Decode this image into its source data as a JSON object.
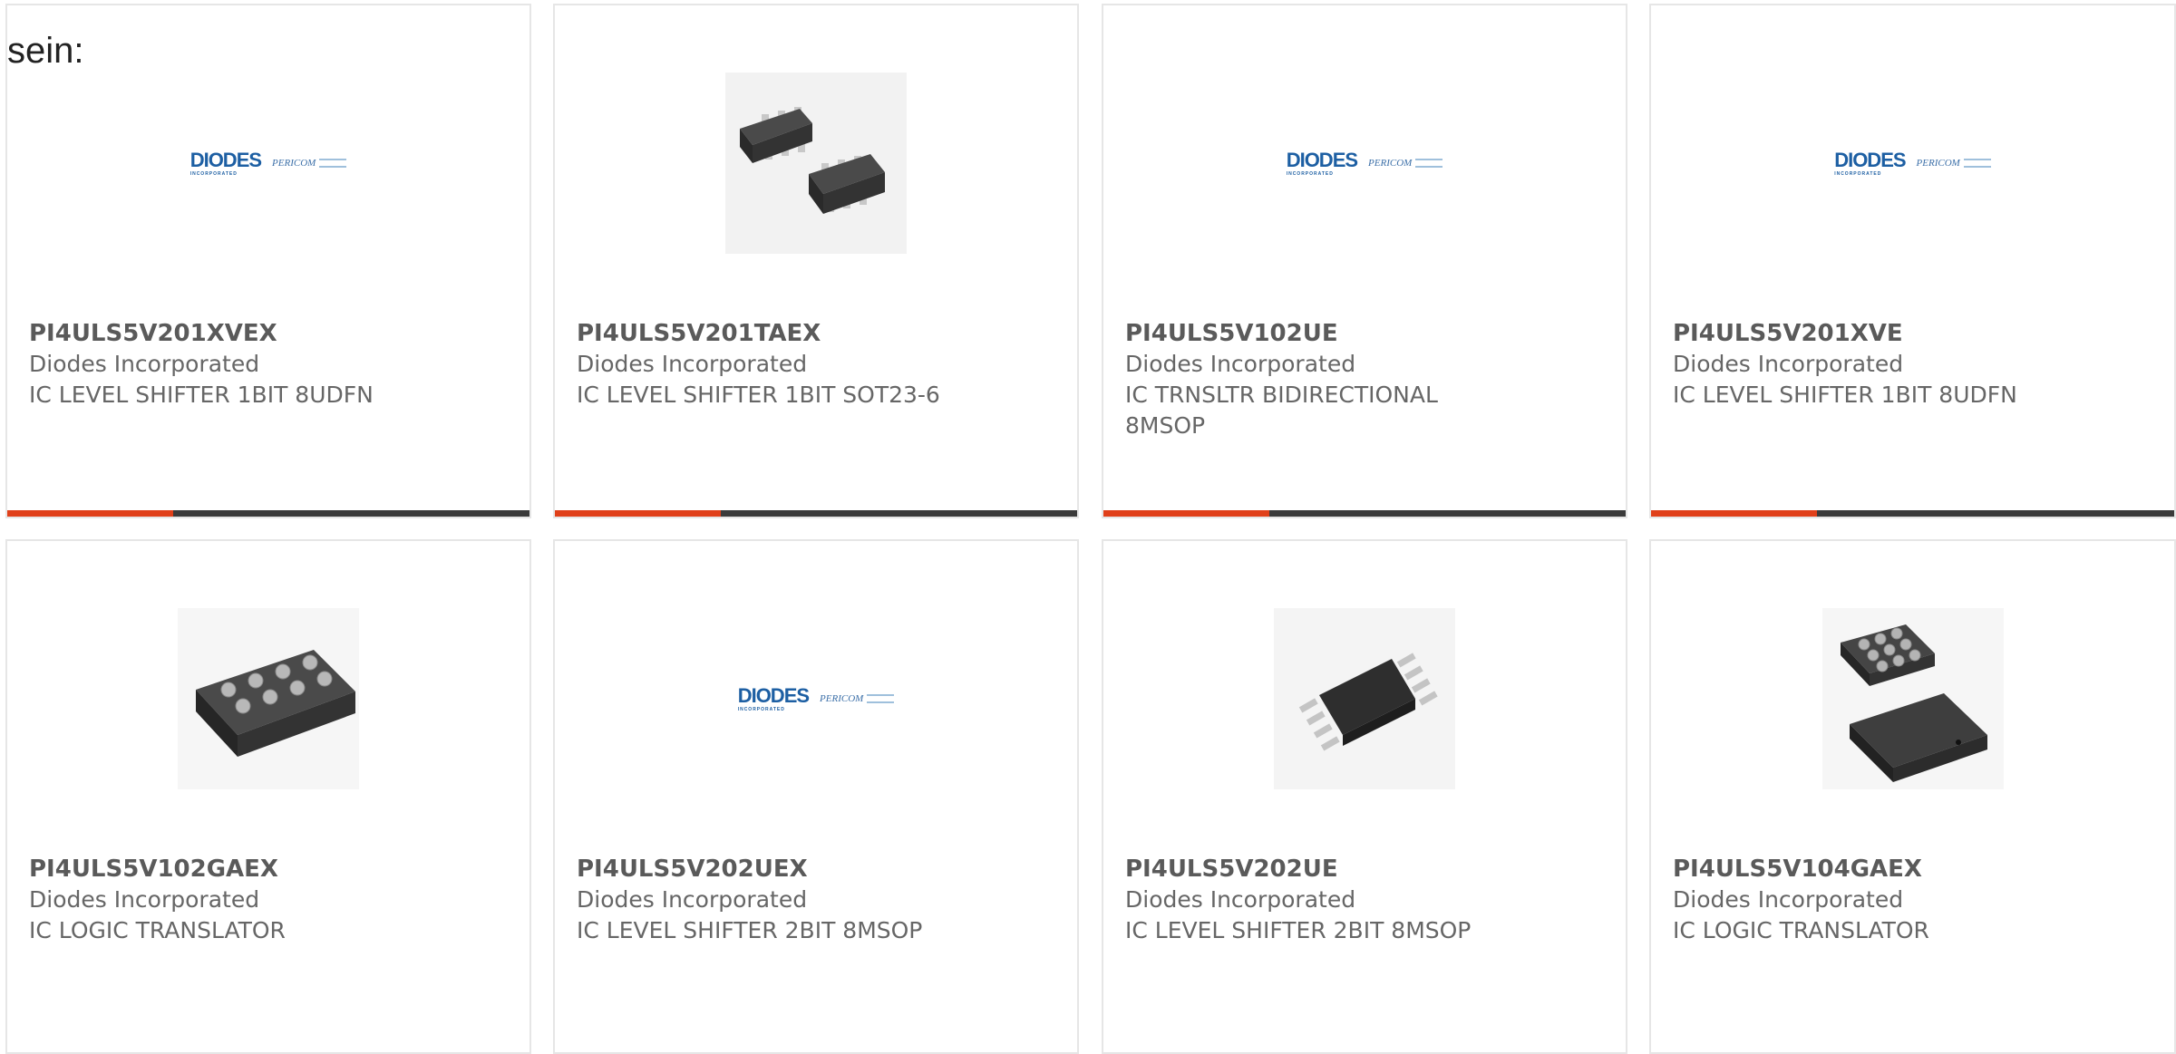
{
  "lead_text": "sein:",
  "products": [
    {
      "part": "PI4ULS5V201XVEX",
      "manufacturer": "Diodes Incorporated",
      "description": "IC LEVEL SHIFTER 1BIT 8UDFN",
      "image": "diodes-logo"
    },
    {
      "part": "PI4ULS5V201TAEX",
      "manufacturer": "Diodes Incorporated",
      "description": "IC LEVEL SHIFTER 1BIT SOT23-6",
      "image": "sot23-6-package"
    },
    {
      "part": "PI4ULS5V102UE",
      "manufacturer": "Diodes Incorporated",
      "description": "IC TRNSLTR BIDIRECTIONAL 8MSOP",
      "image": "diodes-logo"
    },
    {
      "part": "PI4ULS5V201XVE",
      "manufacturer": "Diodes Incorporated",
      "description": "IC LEVEL SHIFTER 1BIT 8UDFN",
      "image": "diodes-logo"
    },
    {
      "part": "PI4ULS5V102GAEX",
      "manufacturer": "Diodes Incorporated",
      "description": "IC LOGIC TRANSLATOR",
      "image": "bga-chip-package"
    },
    {
      "part": "PI4ULS5V202UEX",
      "manufacturer": "Diodes Incorporated",
      "description": "IC LEVEL SHIFTER 2BIT 8MSOP",
      "image": "diodes-logo"
    },
    {
      "part": "PI4ULS5V202UE",
      "manufacturer": "Diodes Incorporated",
      "description": "IC LEVEL SHIFTER 2BIT 8MSOP",
      "image": "msop8-package"
    },
    {
      "part": "PI4ULS5V104GAEX",
      "manufacturer": "Diodes Incorporated",
      "description": "IC LOGIC TRANSLATOR",
      "image": "wlcsp-package"
    }
  ],
  "logo": {
    "brand": "DIODES",
    "brand_tagline": "INCORPORATED",
    "partner": "PERICOM"
  },
  "colors": {
    "accent": "#e0401a",
    "bar": "#3b3b3b",
    "part_text": "#5a5a5a",
    "brand_blue": "#1d5fa3"
  }
}
